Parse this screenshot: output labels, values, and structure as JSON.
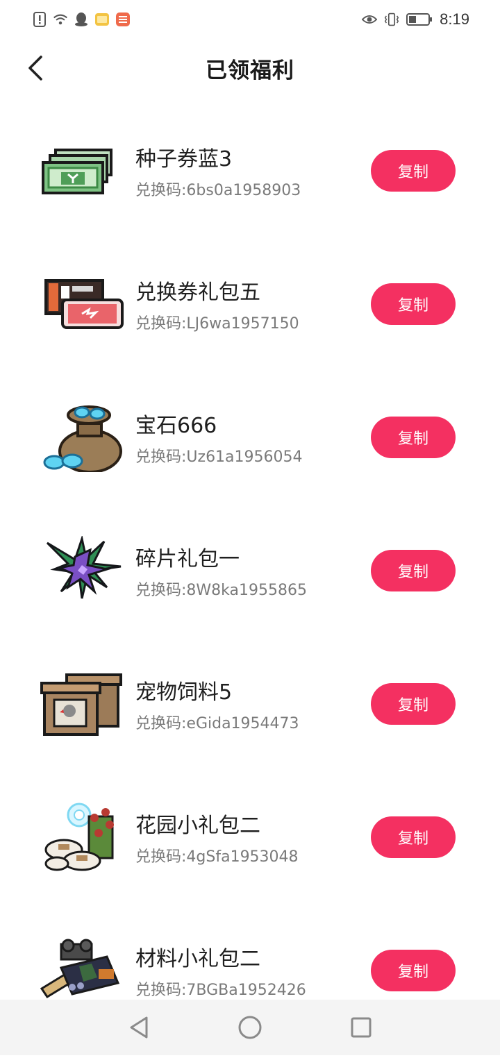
{
  "status_bar": {
    "time": "8:19",
    "left_icons": [
      "alert-icon",
      "wifi-icon",
      "qq-icon",
      "folder-app-icon",
      "app-badge-icon"
    ],
    "right_icons": [
      "eye-icon",
      "vibrate-icon",
      "battery-icon"
    ]
  },
  "header": {
    "title": "已领福利"
  },
  "items": [
    {
      "name": "种子券蓝3",
      "code": "兑换码:6bs0a1958903",
      "copy_label": "复制",
      "icon": "seed-voucher-icon"
    },
    {
      "name": "兑换券礼包五",
      "code": "兑换码:LJ6wa1957150",
      "copy_label": "复制",
      "icon": "ticket-pack-icon"
    },
    {
      "name": "宝石666",
      "code": "兑换码:Uz61a1956054",
      "copy_label": "复制",
      "icon": "gem-bag-icon"
    },
    {
      "name": "碎片礼包一",
      "code": "兑换码:8W8ka1955865",
      "copy_label": "复制",
      "icon": "shard-pack-icon"
    },
    {
      "name": "宠物饲料5",
      "code": "兑换码:eGida1954473",
      "copy_label": "复制",
      "icon": "pet-food-icon"
    },
    {
      "name": "花园小礼包二",
      "code": "兑换码:4gSfa1953048",
      "copy_label": "复制",
      "icon": "garden-pack-icon"
    },
    {
      "name": "材料小礼包二",
      "code": "兑换码:7BGBa1952426",
      "copy_label": "复制",
      "icon": "material-pack-icon"
    }
  ],
  "colors": {
    "accent": "#f43061",
    "text_primary": "#1f1f1f",
    "text_secondary": "#7a7a7a",
    "nav_bg": "#f4f4f4"
  },
  "nav": [
    "back-triangle-icon",
    "home-circle-icon",
    "recent-square-icon"
  ]
}
